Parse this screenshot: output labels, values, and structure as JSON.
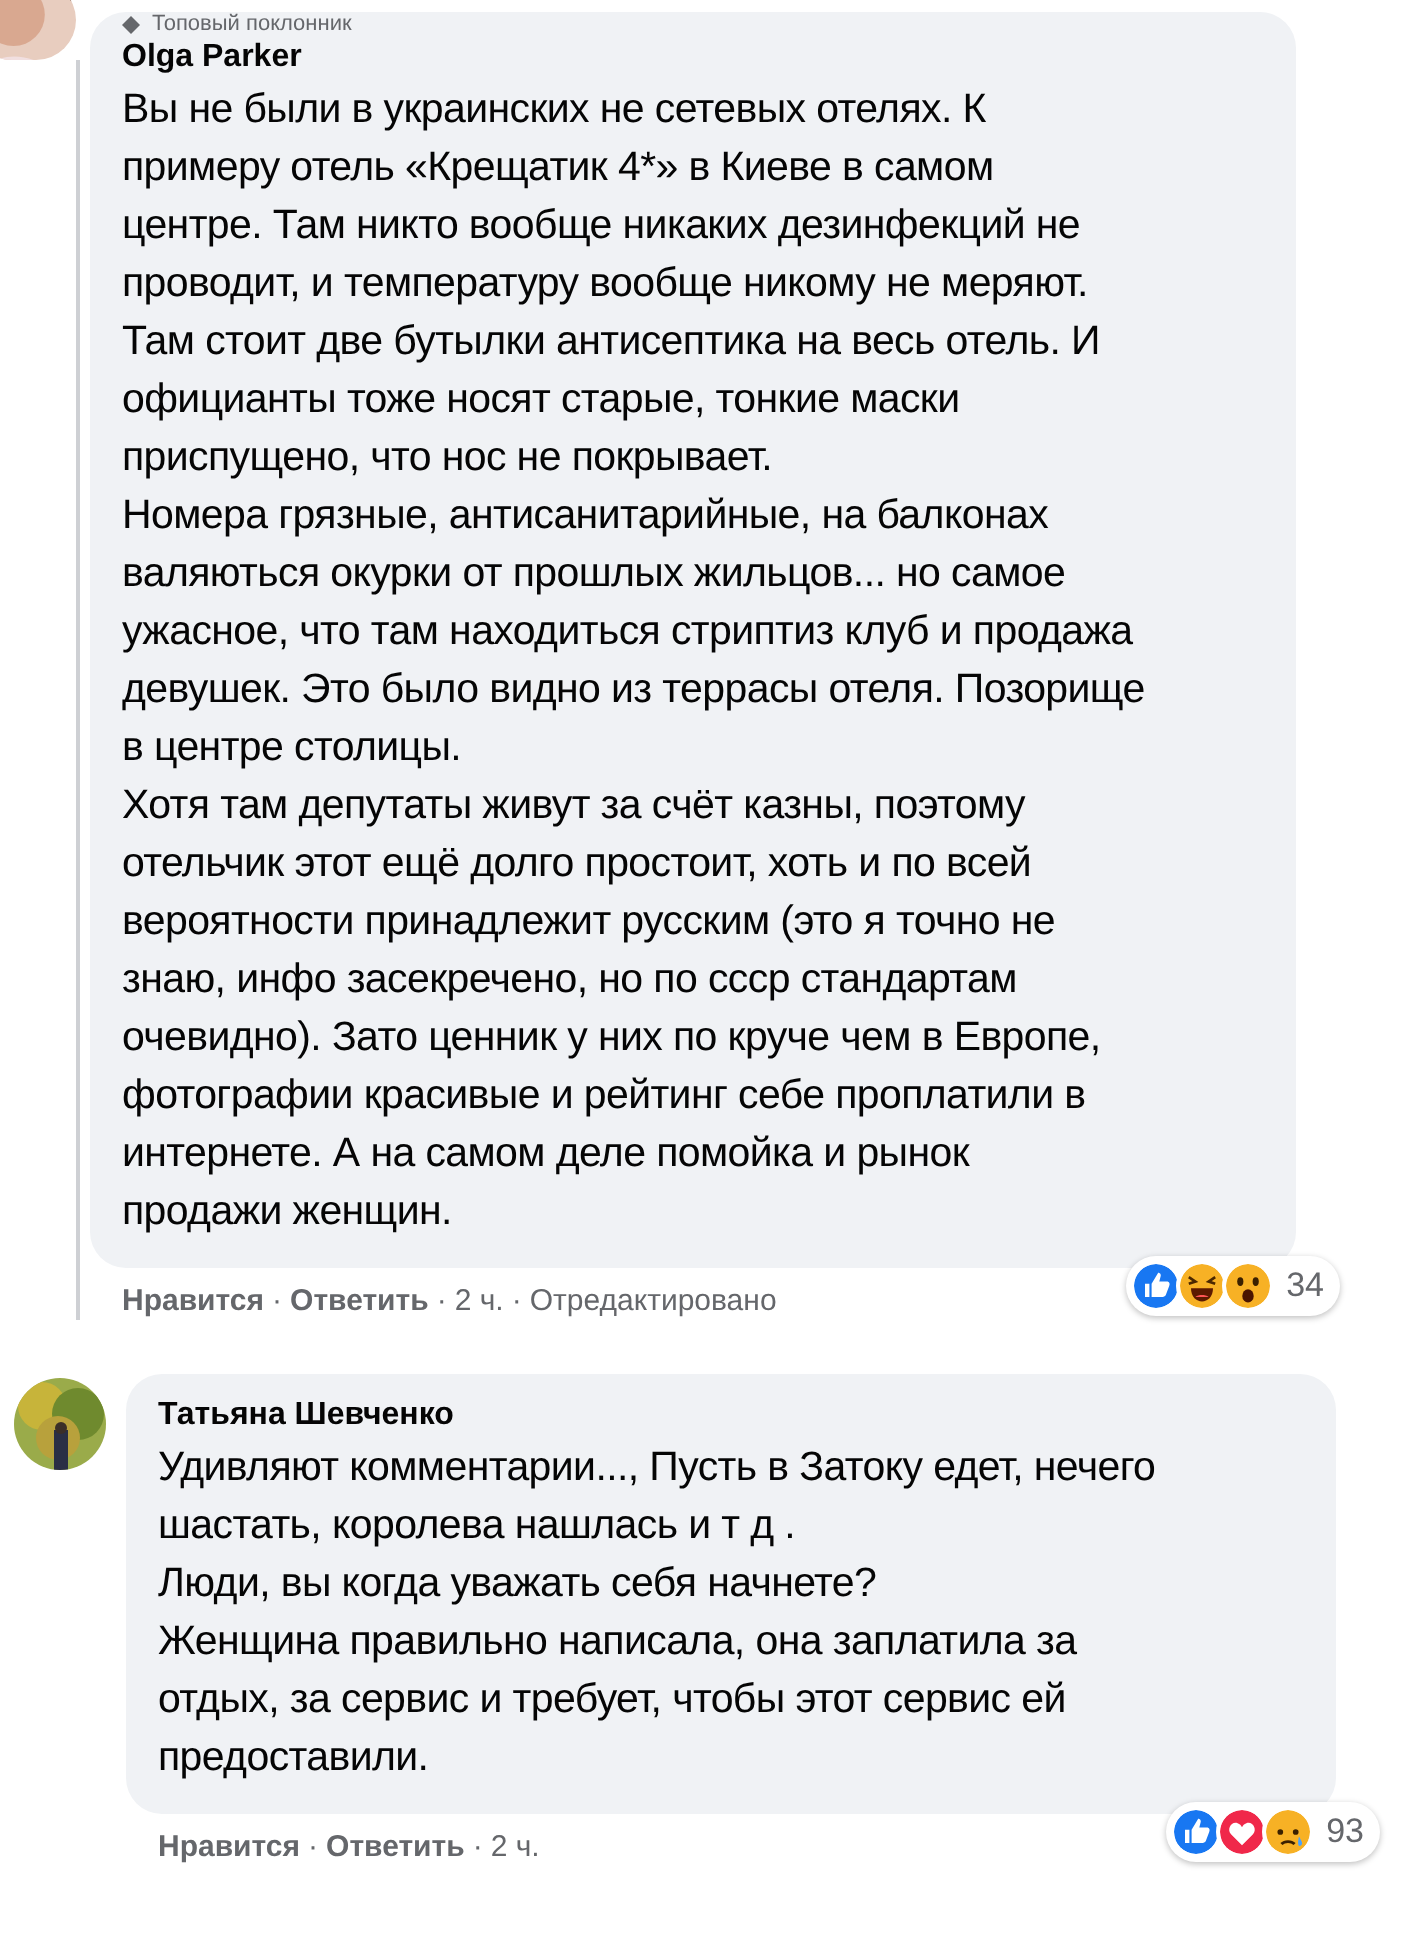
{
  "separator": "·",
  "comments": [
    {
      "badge": "Топовый поклонник",
      "author": "Olga Parker",
      "lines": [
        "Вы не были в украинских не сетевых отелях. К",
        "примеру отель «Крещатик 4*» в Киеве в самом",
        "центре. Там никто вообще никаких дезинфекций не",
        "проводит, и температуру вообще никому не меряют.",
        "Там стоит две бутылки антисептика на весь отель. И",
        "официанты тоже носят старые, тонкие маски",
        "приспущено, что нос не покрывает.",
        "Номера грязные, антисанитарийные, на балконах",
        "валяються окурки от прошлых жильцов... но самое",
        "ужасное, что там находиться стриптиз клуб и продажа",
        "девушек. Это было видно из террасы отеля. Позорище",
        "в центре столицы.",
        "Хотя там депутаты живут за счёт казны, поэтому",
        "отельчик этот ещё долго простоит, хоть и по всей",
        "вероятности принадлежит русским (это я точно не",
        "знаю, инфо засекречено, но по ссср стандартам",
        "очевидно). Зато ценник у них по круче чем в Европе,",
        "фотографии красивые и рейтинг себе проплатили в",
        "интернете. А на самом деле помойка и рынок",
        "продажи женщин."
      ],
      "actions": [
        {
          "kind": "link",
          "text": "Нравится"
        },
        {
          "kind": "link",
          "text": "Ответить"
        },
        {
          "kind": "meta",
          "text": "2 ч."
        },
        {
          "kind": "meta",
          "text": "Отредактировано"
        }
      ],
      "reactions": [
        {
          "kind": "like"
        },
        {
          "kind": "haha"
        },
        {
          "kind": "wow"
        }
      ],
      "reaction_count": "34"
    },
    {
      "author": "Татьяна Шевченко",
      "lines": [
        "Удивляют комментарии..., Пусть в Затоку едет, нечего",
        "шастать, королева нашлась и т д .",
        "Люди, вы когда уважать себя начнете?",
        "Женщина правильно написала, она заплатила за",
        "отдых, за сервис и требует, чтобы этот сервис ей",
        "предоставили."
      ],
      "actions": [
        {
          "kind": "link",
          "text": "Нравится"
        },
        {
          "kind": "link",
          "text": "Ответить"
        },
        {
          "kind": "meta",
          "text": "2 ч."
        }
      ],
      "reactions": [
        {
          "kind": "like"
        },
        {
          "kind": "love"
        },
        {
          "kind": "sad"
        }
      ],
      "reaction_count": "93"
    }
  ]
}
